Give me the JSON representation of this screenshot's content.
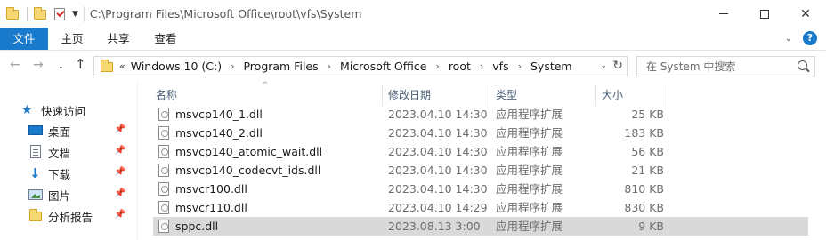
{
  "window": {
    "title_path": "C:\\Program Files\\Microsoft Office\\root\\vfs\\System"
  },
  "ribbon": {
    "tabs": [
      {
        "label": "文件"
      },
      {
        "label": "主页"
      },
      {
        "label": "共享"
      },
      {
        "label": "查看"
      }
    ]
  },
  "address_bar": {
    "overflow": "«",
    "crumbs": [
      "Windows 10 (C:)",
      "Program Files",
      "Microsoft Office",
      "root",
      "vfs",
      "System"
    ]
  },
  "search": {
    "placeholder": "在 System 中搜索"
  },
  "nav_pane": {
    "items": [
      {
        "label": "快速访问",
        "icon": "star-icon",
        "pinned": false
      },
      {
        "label": "桌面",
        "icon": "desktop-icon",
        "pinned": true
      },
      {
        "label": "文档",
        "icon": "document-icon",
        "pinned": true
      },
      {
        "label": "下载",
        "icon": "download-icon",
        "pinned": true
      },
      {
        "label": "图片",
        "icon": "pictures-icon",
        "pinned": true
      },
      {
        "label": "分析报告",
        "icon": "folder-icon",
        "pinned": true
      }
    ]
  },
  "file_list": {
    "columns": {
      "name": "名称",
      "date": "修改日期",
      "type": "类型",
      "size": "大小"
    },
    "rows": [
      {
        "name": "msvcp140_1.dll",
        "date": "2023.04.10 14:30",
        "type": "应用程序扩展",
        "size": "25 KB",
        "selected": false
      },
      {
        "name": "msvcp140_2.dll",
        "date": "2023.04.10 14:30",
        "type": "应用程序扩展",
        "size": "183 KB",
        "selected": false
      },
      {
        "name": "msvcp140_atomic_wait.dll",
        "date": "2023.04.10 14:30",
        "type": "应用程序扩展",
        "size": "56 KB",
        "selected": false
      },
      {
        "name": "msvcp140_codecvt_ids.dll",
        "date": "2023.04.10 14:30",
        "type": "应用程序扩展",
        "size": "21 KB",
        "selected": false
      },
      {
        "name": "msvcr100.dll",
        "date": "2023.04.10 14:30",
        "type": "应用程序扩展",
        "size": "810 KB",
        "selected": false
      },
      {
        "name": "msvcr110.dll",
        "date": "2023.04.10 14:29",
        "type": "应用程序扩展",
        "size": "830 KB",
        "selected": false
      },
      {
        "name": "sppc.dll",
        "date": "2023.08.13 3:00",
        "type": "应用程序扩展",
        "size": "9 KB",
        "selected": true
      }
    ]
  },
  "colors": {
    "accent": "#1979ca",
    "selected_row": "#d9d9d9",
    "header_text": "#4c607a"
  }
}
